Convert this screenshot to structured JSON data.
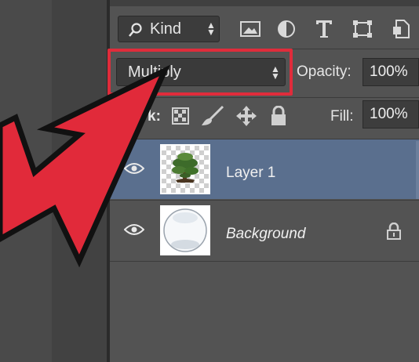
{
  "layers_panel": {
    "filter": {
      "label": "Kind"
    },
    "filter_icons": [
      "image-filter-icon",
      "adjustment-filter-icon",
      "type-filter-icon",
      "shape-filter-icon",
      "smart-object-filter-icon"
    ],
    "blend_mode": {
      "value": "Multiply"
    },
    "opacity": {
      "label": "Opacity:",
      "value": "100%"
    },
    "lock": {
      "label": "k:",
      "icons": [
        "lock-transparent-icon",
        "lock-image-icon",
        "lock-position-icon",
        "lock-all-icon"
      ]
    },
    "fill": {
      "label": "Fill:",
      "value": "100%"
    },
    "layers": [
      {
        "name": "Layer 1",
        "visible": true,
        "selected": true,
        "locked": false
      },
      {
        "name": "Background",
        "visible": true,
        "selected": false,
        "locked": true
      }
    ]
  },
  "colors": {
    "panel_bg": "#535353",
    "selection": "#5a6f8e",
    "highlight_outline": "#e02c3b",
    "arrow": "#e12a3a"
  }
}
